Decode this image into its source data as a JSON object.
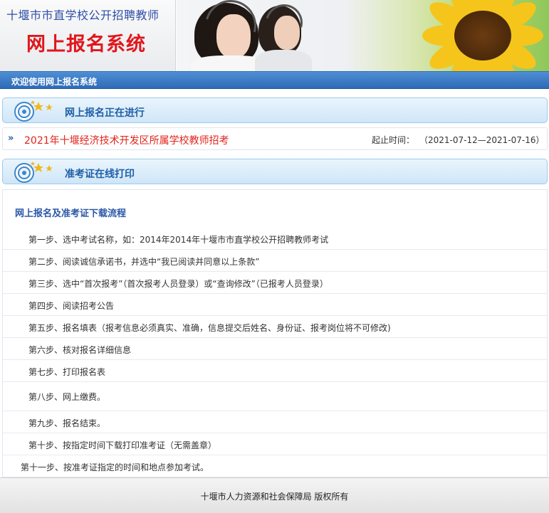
{
  "banner": {
    "title": "十堰市市直学校公开招聘教师",
    "subtitle": "网上报名系统"
  },
  "welcome": "欢迎使用网上报名系统",
  "sections": {
    "registration_open": "网上报名正在进行",
    "admission_print": "准考证在线打印"
  },
  "exam": {
    "name": "2021年十堰经济技术开发区所属学校教师招考",
    "date_label": "起止时间：",
    "date_value": "（2021-07-12—2021-07-16）"
  },
  "process": {
    "title": "网上报名及准考证下载流程",
    "steps": [
      "第一步、选中考试名称，如：2014年2014年十堰市市直学校公开招聘教师考试",
      "第二步、阅读诚信承诺书，并选中“我已阅读并同意以上条款”",
      "第三步、选中“首次报考”（首次报考人员登录）或“查询修改”（已报考人员登录）",
      "第四步、阅读招考公告",
      "第五步、报名填表（报考信息必须真实、准确，信息提交后姓名、身份证、报考岗位将不可修改)",
      "第六步、核对报名详细信息",
      "第七步、打印报名表",
      "第八步、网上缴费。",
      "第九步、报名结束。",
      "第十步、按指定时间下载打印准考证（无需盖章）",
      "第十一步、按准考证指定的时间和地点参加考试。"
    ]
  },
  "footer": "十堰市人力资源和社会保障局 版权所有",
  "colors": {
    "accent_blue": "#2e6bb7",
    "link_red": "#e2231a",
    "title_blue": "#2e4fa8",
    "subtitle_red": "#e0161c"
  },
  "icons": {
    "section_icon": "megaphone-stars-icon",
    "exam_bullet": "double-chevron-right-icon"
  }
}
